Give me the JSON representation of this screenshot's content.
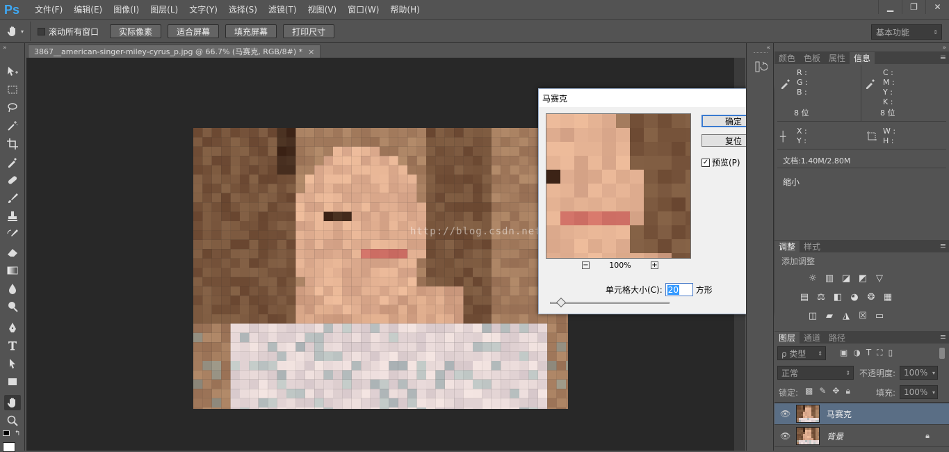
{
  "app": {
    "logo": "Ps"
  },
  "menu": [
    "文件(F)",
    "编辑(E)",
    "图像(I)",
    "图层(L)",
    "文字(Y)",
    "选择(S)",
    "滤镜(T)",
    "视图(V)",
    "窗口(W)",
    "帮助(H)"
  ],
  "window_buttons": {
    "minimize": "▁",
    "restore": "❐",
    "close": "✕"
  },
  "options": {
    "scroll_all_label": "滚动所有窗口",
    "buttons": [
      "实际像素",
      "适合屏幕",
      "填充屏幕",
      "打印尺寸"
    ],
    "workspace": "基本功能"
  },
  "document": {
    "tab_title": "3867__american-singer-miley-cyrus_p.jpg @ 66.7% (马赛克, RGB/8#) *",
    "close": "×"
  },
  "watermark": "http://blog.csdn.net",
  "dialog": {
    "title": "马赛克",
    "close": "✕",
    "ok": "确定",
    "reset": "复位",
    "preview_label": "预览(P)",
    "preview_checked": true,
    "zoom_minus": "−",
    "zoom_plus": "+",
    "zoom": "100%",
    "cell_label": "单元格大小(C):",
    "cell_value": "20",
    "cell_unit": "方形"
  },
  "info_panel": {
    "tabs": [
      "颜色",
      "色板",
      "属性",
      "信息"
    ],
    "active_tab": 3,
    "rgb": [
      "R :",
      "G :",
      "B :"
    ],
    "cmyk": [
      "C :",
      "M :",
      "Y :",
      "K :"
    ],
    "bits_left": "8 位",
    "bits_right": "8 位",
    "xy": [
      "X :",
      "Y :"
    ],
    "wh": [
      "W :",
      "H :"
    ],
    "doc": "文档:1.40M/2.80M",
    "hint": "缩小"
  },
  "adjust_panel": {
    "tabs": [
      "调整",
      "样式"
    ],
    "active_tab": 0,
    "add_label": "添加调整"
  },
  "layers_panel": {
    "tabs": [
      "图层",
      "通道",
      "路径"
    ],
    "active_tab": 0,
    "filter_kind": "ρ 类型",
    "blend_mode": "正常",
    "opacity_label": "不透明度:",
    "opacity": "100%",
    "lock_label": "锁定:",
    "fill_label": "填充:",
    "fill": "100%",
    "layers": [
      {
        "name": "马赛克",
        "selected": true,
        "locked": false
      },
      {
        "name": "背景",
        "selected": false,
        "locked": true
      }
    ]
  },
  "colors": {
    "accent": "#3fa9f5",
    "selected_layer": "#5a6e85"
  }
}
